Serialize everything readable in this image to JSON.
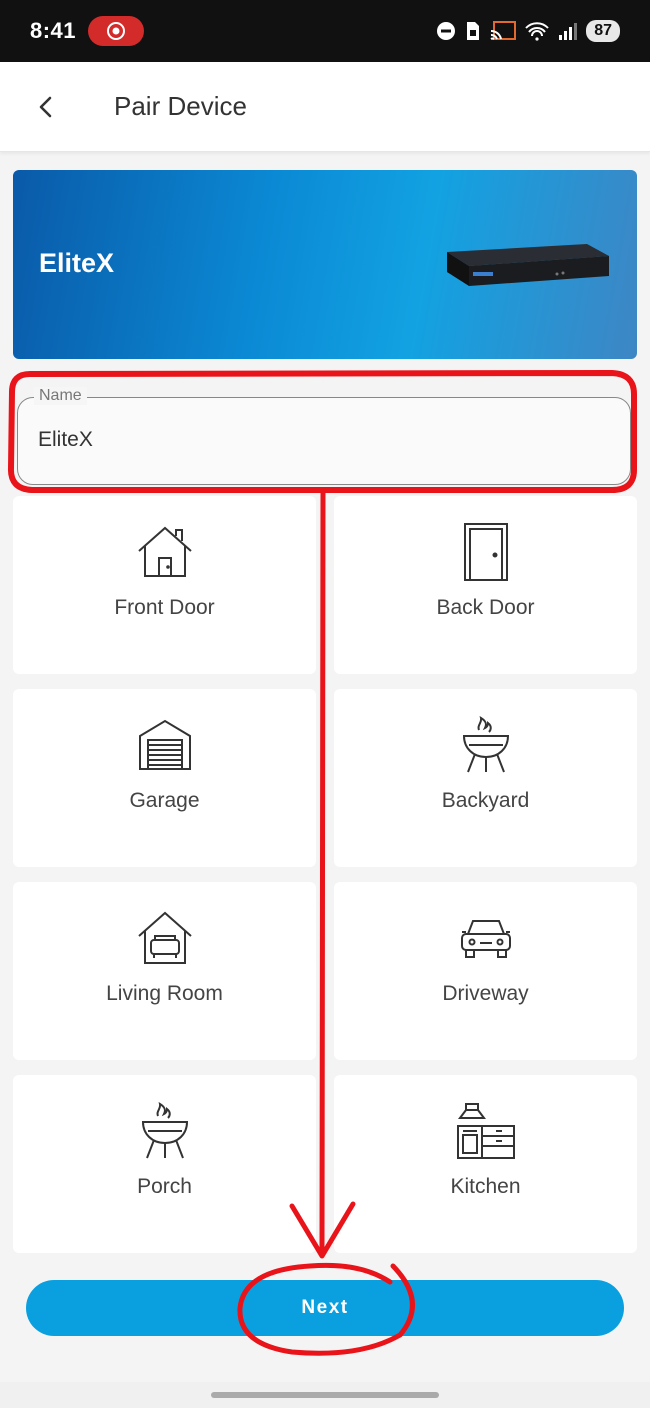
{
  "status_bar": {
    "time": "8:41",
    "battery": "87",
    "icons": [
      "screen-record-icon",
      "do-not-disturb-icon",
      "sim-icon",
      "cast-icon",
      "wifi-icon",
      "signal-icon",
      "battery-icon"
    ]
  },
  "app_bar": {
    "title": "Pair Device",
    "back_icon": "chevron-left-icon"
  },
  "banner": {
    "title": "EliteX",
    "image": "nvr-device-image"
  },
  "name_field": {
    "label": "Name",
    "value": "EliteX"
  },
  "locations": [
    {
      "label": "Front Door",
      "icon": "house-icon"
    },
    {
      "label": "Back Door",
      "icon": "door-icon"
    },
    {
      "label": "Garage",
      "icon": "garage-icon"
    },
    {
      "label": "Backyard",
      "icon": "grill-icon"
    },
    {
      "label": "Living Room",
      "icon": "sofa-house-icon"
    },
    {
      "label": "Driveway",
      "icon": "car-icon"
    },
    {
      "label": "Porch",
      "icon": "grill-icon"
    },
    {
      "label": "Kitchen",
      "icon": "kitchen-icon"
    }
  ],
  "next_button": {
    "label": "Next"
  },
  "colors": {
    "accent": "#0aa0e0",
    "annotation": "#e8141a",
    "banner_start": "#0a5aa8",
    "banner_end": "#3e86c4"
  }
}
